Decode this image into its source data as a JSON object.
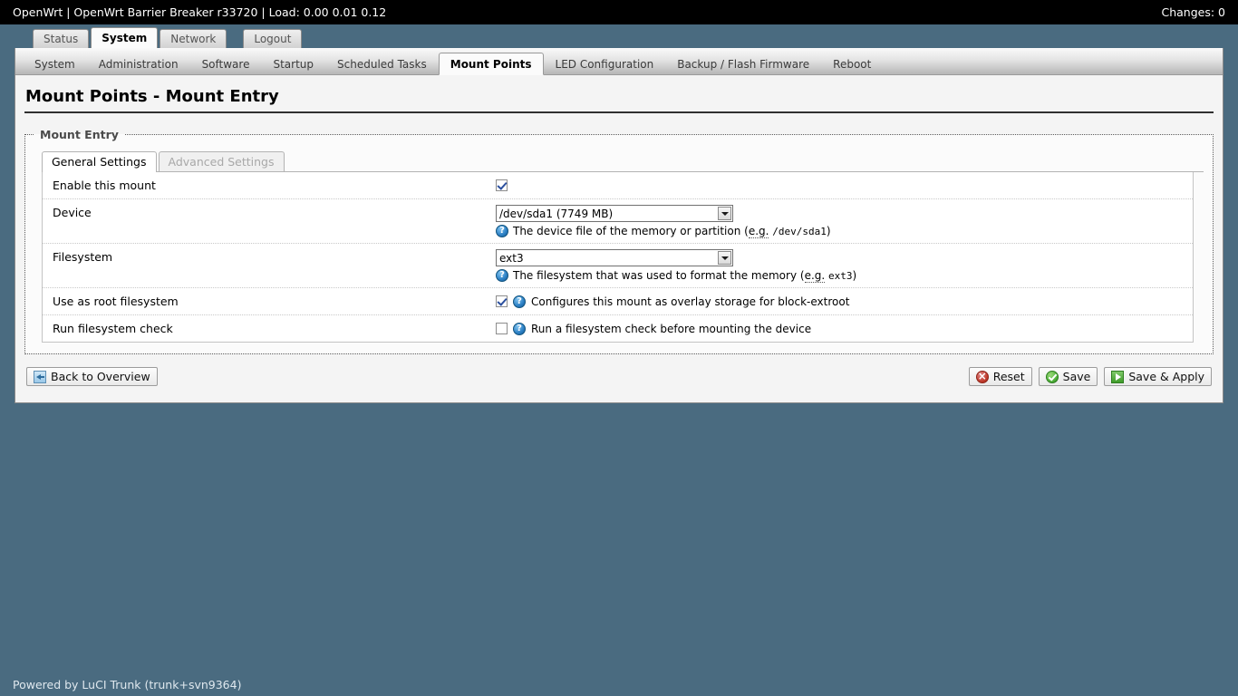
{
  "header": {
    "title": "OpenWrt | OpenWrt Barrier Breaker r33720 | Load: 0.00 0.01 0.12",
    "changes": "Changes: 0"
  },
  "main_tabs": [
    {
      "label": "Status",
      "active": false
    },
    {
      "label": "System",
      "active": true
    },
    {
      "label": "Network",
      "active": false
    },
    {
      "label": "Logout",
      "active": false
    }
  ],
  "sub_tabs": [
    {
      "label": "System",
      "active": false
    },
    {
      "label": "Administration",
      "active": false
    },
    {
      "label": "Software",
      "active": false
    },
    {
      "label": "Startup",
      "active": false
    },
    {
      "label": "Scheduled Tasks",
      "active": false
    },
    {
      "label": "Mount Points",
      "active": true
    },
    {
      "label": "LED Configuration",
      "active": false
    },
    {
      "label": "Backup / Flash Firmware",
      "active": false
    },
    {
      "label": "Reboot",
      "active": false
    }
  ],
  "page": {
    "title": "Mount Points - Mount Entry",
    "fieldset_legend": "Mount Entry"
  },
  "inner_tabs": [
    {
      "label": "General Settings",
      "active": true
    },
    {
      "label": "Advanced Settings",
      "active": false
    }
  ],
  "form": {
    "enable_mount": {
      "label": "Enable this mount",
      "checked": true
    },
    "device": {
      "label": "Device",
      "value": "/dev/sda1 (7749 MB)",
      "options": [
        "/dev/sda1 (7749 MB)"
      ],
      "help_prefix": "The device file of the memory or partition (",
      "help_abbr": "e.g.",
      "help_code": "/dev/sda1",
      "help_suffix": ")"
    },
    "filesystem": {
      "label": "Filesystem",
      "value": "ext3",
      "options": [
        "ext3"
      ],
      "help_prefix": "The filesystem that was used to format the memory (",
      "help_abbr": "e.g.",
      "help_code": "ext3",
      "help_suffix": ")"
    },
    "root_filesystem": {
      "label": "Use as root filesystem",
      "checked": true,
      "help": "Configures this mount as overlay storage for block-extroot"
    },
    "fsck": {
      "label": "Run filesystem check",
      "checked": false,
      "help": "Run a filesystem check before mounting the device"
    }
  },
  "actions": {
    "back": "Back to Overview",
    "reset": "Reset",
    "save": "Save",
    "save_apply": "Save & Apply"
  },
  "footer": {
    "text": "Powered by LuCI Trunk (trunk+svn9364)"
  },
  "icons": {
    "help": "?"
  },
  "colors": {
    "background": "#4a6b80",
    "header_bg": "#000000",
    "panel_bg": "#f4f4f4",
    "accent_blue": "#2b7fc4",
    "reset_red": "#c0392b",
    "save_green": "#4caf37"
  }
}
